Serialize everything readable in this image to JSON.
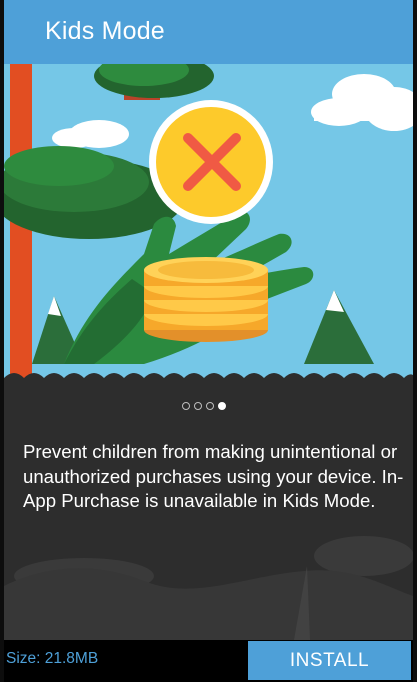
{
  "app_bar": {
    "title": "Kids Mode"
  },
  "carousel": {
    "page_count": 4,
    "active_index": 3,
    "illustration": "hand-holding-coins-no-purchase",
    "badge_icon": "no-purchase-x-icon"
  },
  "description": "Prevent children from making unintentional or unauthorized purchases using your device. In-App Purchase is unavailable in Kids Mode.",
  "footer": {
    "size_label": "Size: 21.8MB",
    "install_label": "INSTALL"
  },
  "colors": {
    "accent": "#4ea0d8",
    "sky": "#75c7e7",
    "badge": "#fdca2b",
    "x_mark": "#f05a44",
    "coin": "#f6a82a"
  }
}
